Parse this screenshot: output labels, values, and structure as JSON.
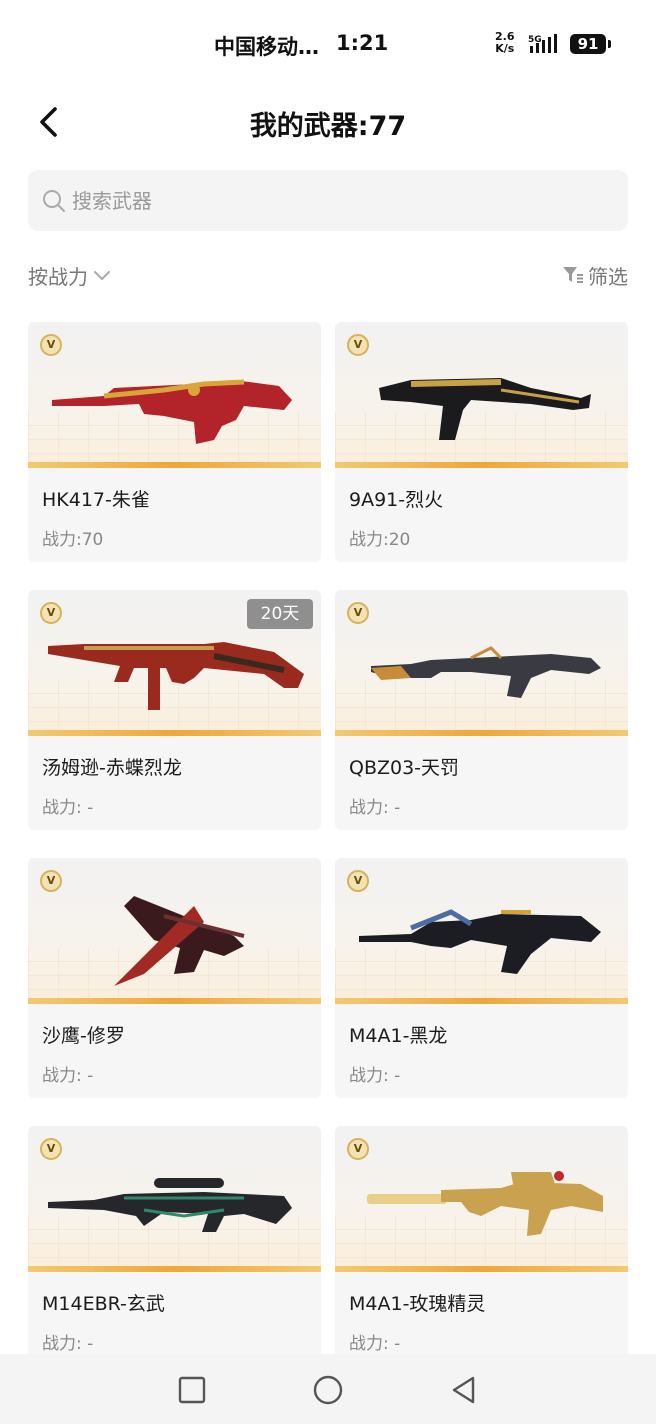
{
  "status": {
    "carrier": "中国移动…",
    "time": "1:21",
    "speed_value": "2.6",
    "speed_unit": "K/s",
    "network": "5G",
    "battery": "91"
  },
  "header": {
    "title": "我的武器:77"
  },
  "search": {
    "placeholder": "搜索武器"
  },
  "toolbar": {
    "sort_label": "按战力",
    "filter_label": "筛选"
  },
  "weapons": [
    {
      "name": "HK417-朱雀",
      "power": "战力:70",
      "badge": "",
      "colors": [
        "#b3232a",
        "#d9a53a"
      ]
    },
    {
      "name": "9A91-烈火",
      "power": "战力:20",
      "badge": "",
      "colors": [
        "#1b1a1c",
        "#c7a047"
      ]
    },
    {
      "name": "汤姆逊-赤蝶烈龙",
      "power": "战力: -",
      "badge": "20天",
      "colors": [
        "#9b2a1e",
        "#c99a52"
      ]
    },
    {
      "name": "QBZ03-天罚",
      "power": "战力: -",
      "badge": "",
      "colors": [
        "#3a3b42",
        "#c88b3a"
      ]
    },
    {
      "name": "沙鹰-修罗",
      "power": "战力: -",
      "badge": "",
      "colors": [
        "#3a1a1c",
        "#a12a25"
      ]
    },
    {
      "name": "M4A1-黑龙",
      "power": "战力: -",
      "badge": "",
      "colors": [
        "#1c1d22",
        "#4b6da3"
      ]
    },
    {
      "name": "M14EBR-玄武",
      "power": "战力: -",
      "badge": "",
      "colors": [
        "#25272b",
        "#2f8a6d"
      ]
    },
    {
      "name": "M4A1-玫瑰精灵",
      "power": "战力: -",
      "badge": "",
      "colors": [
        "#c9a14f",
        "#e9cf87"
      ]
    }
  ],
  "vip_badge": "V",
  "colors": {
    "accent_stripe": "#eea73b",
    "card_bg": "#f6f6f6",
    "muted_text": "#888888"
  }
}
